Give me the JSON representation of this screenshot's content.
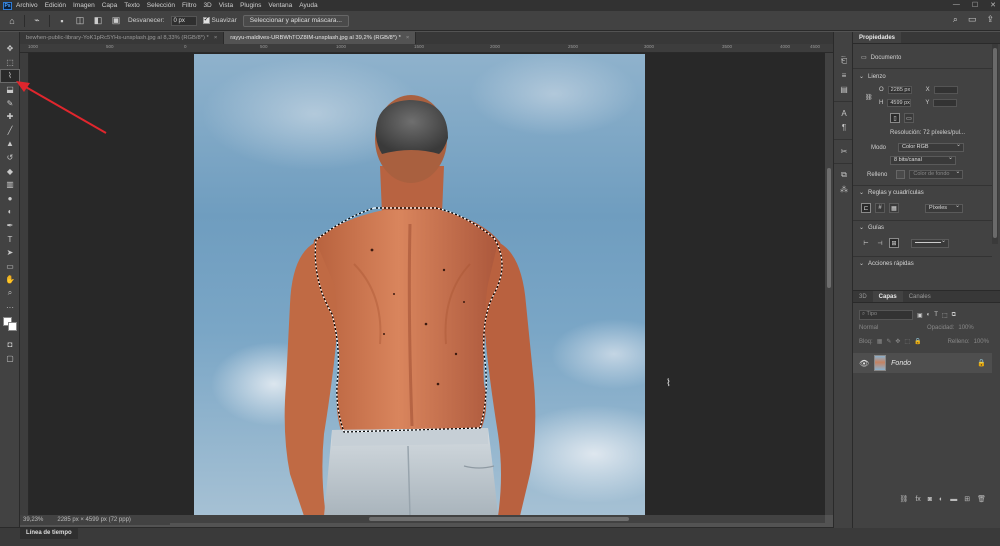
{
  "app": {
    "logo": "Ps"
  },
  "menu": [
    "Archivo",
    "Edición",
    "Imagen",
    "Capa",
    "Texto",
    "Selección",
    "Filtro",
    "3D",
    "Vista",
    "Plugins",
    "Ventana",
    "Ayuda"
  ],
  "window_controls": {
    "minimize": "—",
    "maximize": "☐",
    "close": "✕"
  },
  "options_bar": {
    "difuminar_label": "Desvanecer:",
    "difuminar_value": "0 px",
    "suavizar_label": "Suavizar",
    "select_mask_button": "Seleccionar y aplicar máscara..."
  },
  "tabs": [
    {
      "label": "bewhen-public-library-YoK1pRc5YHs-unsplash.jpg al 8,33% (RGB/8*) *",
      "close": "×",
      "active": false
    },
    {
      "label": "rayyu-maldives-URBWhTOZ8IM-unsplash.jpg al 39,2% (RGB/8*) *",
      "close": "×",
      "active": true
    }
  ],
  "ruler_ticks": [
    "1000",
    "500",
    "0",
    "500",
    "1000",
    "1500",
    "2000",
    "2500",
    "3000",
    "3500",
    "4000",
    "4500"
  ],
  "status": {
    "zoom": "39,23%",
    "doc_size": "2285 px × 4599 px (72 ppp)"
  },
  "timeline": {
    "label": "Línea de tiempo"
  },
  "properties": {
    "tab": "Propiedades",
    "doc_label": "Documento",
    "lienzo_title": "Lienzo",
    "width_label": "O",
    "width_value": "2285 px",
    "height_label": "H",
    "height_value": "4599 px",
    "x_label": "X",
    "y_label": "Y",
    "resolution": "Resolución: 72 píxeles/pul...",
    "mode_label": "Modo",
    "mode_value": "Color RGB",
    "bits_value": "8 bits/canal",
    "fill_label": "Relleno",
    "fill_value": "Color de fondo",
    "rulers_title": "Reglas y cuadrículas",
    "units_value": "Píxeles",
    "guides_title": "Guías",
    "quick_actions_title": "Acciones rápidas"
  },
  "layers_panel": {
    "tabs": [
      "3D",
      "Capas",
      "Canales"
    ],
    "active_tab": "Capas",
    "search_placeholder": "Tipo",
    "blend_mode": "Normal",
    "opacity_label": "Opacidad:",
    "opacity_value": "100%",
    "lock_label": "Bloq:",
    "fill_label": "Relleno:",
    "fill_value": "100%",
    "layer_name": "Fondo"
  },
  "icons": {
    "tools": [
      "move-icon",
      "marquee-icon",
      "magnetic-lasso-icon",
      "object-select-icon",
      "eyedropper-icon",
      "healing-icon",
      "brush-icon",
      "stamp-icon",
      "history-brush-icon",
      "eraser-icon",
      "gradient-icon",
      "blur-icon",
      "dodge-icon",
      "pen-icon",
      "type-icon",
      "path-select-icon",
      "rectangle-icon",
      "hand-icon",
      "zoom-icon",
      "more-tools-icon"
    ]
  },
  "colors": {
    "accent": "#2e7bd6",
    "panel": "#424242",
    "canvas_bg": "#282828",
    "annotation": "#e0262d",
    "selection": "#ffffff"
  }
}
